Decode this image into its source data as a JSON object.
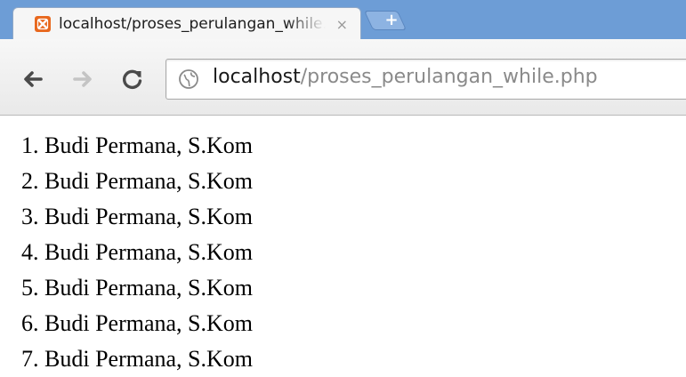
{
  "tab": {
    "title": "localhost/proses_perulangan_while.php",
    "close": "×",
    "new_tab": "+"
  },
  "toolbar": {
    "back_icon": "back-arrow-icon",
    "forward_icon": "forward-arrow-icon",
    "reload_icon": "reload-icon"
  },
  "address": {
    "host": "localhost",
    "path": "/proses_perulangan_while.php"
  },
  "colors": {
    "tabstrip": "#6d9dd6",
    "favicon": "#e8681e",
    "url_path": "#8a8a8a"
  },
  "content": {
    "lines": [
      "1. Budi Permana, S.Kom",
      "2. Budi Permana, S.Kom",
      "3. Budi Permana, S.Kom",
      "4. Budi Permana, S.Kom",
      "5. Budi Permana, S.Kom",
      "6. Budi Permana, S.Kom",
      "7. Budi Permana, S.Kom"
    ]
  }
}
